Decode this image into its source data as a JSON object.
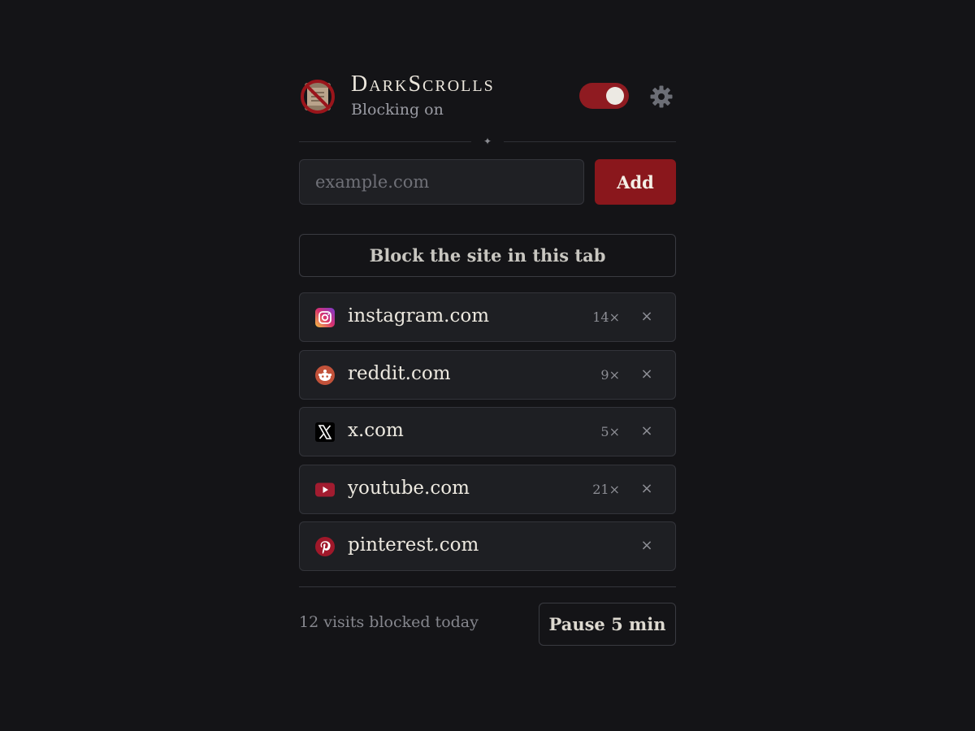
{
  "header": {
    "title": "DarkScrolls",
    "status": "Blocking on",
    "logo_icon": "no-scroll-logo-icon",
    "toggle_on": true,
    "settings_icon": "gear-icon"
  },
  "divider_glyph": "✦",
  "add_site": {
    "placeholder": "example.com",
    "value": "",
    "button_label": "Add"
  },
  "block_current_tab_label": "Block the site in this tab",
  "sites": [
    {
      "name": "instagram.com",
      "count": "14×",
      "icon": "instagram-icon",
      "remove": "×"
    },
    {
      "name": "reddit.com",
      "count": "9×",
      "icon": "reddit-icon",
      "remove": "×"
    },
    {
      "name": "x.com",
      "count": "5×",
      "icon": "x-icon",
      "remove": "×"
    },
    {
      "name": "youtube.com",
      "count": "21×",
      "icon": "youtube-icon",
      "remove": "×"
    },
    {
      "name": "pinterest.com",
      "count": "",
      "icon": "pinterest-icon",
      "remove": "×"
    }
  ],
  "footer": {
    "stat": "12 visits blocked today",
    "pause_label": "Pause 5 min"
  },
  "colors": {
    "background": "#141417",
    "accent": "#8a171c",
    "card": "#1e1f23",
    "muted_text": "#8d8e95"
  }
}
